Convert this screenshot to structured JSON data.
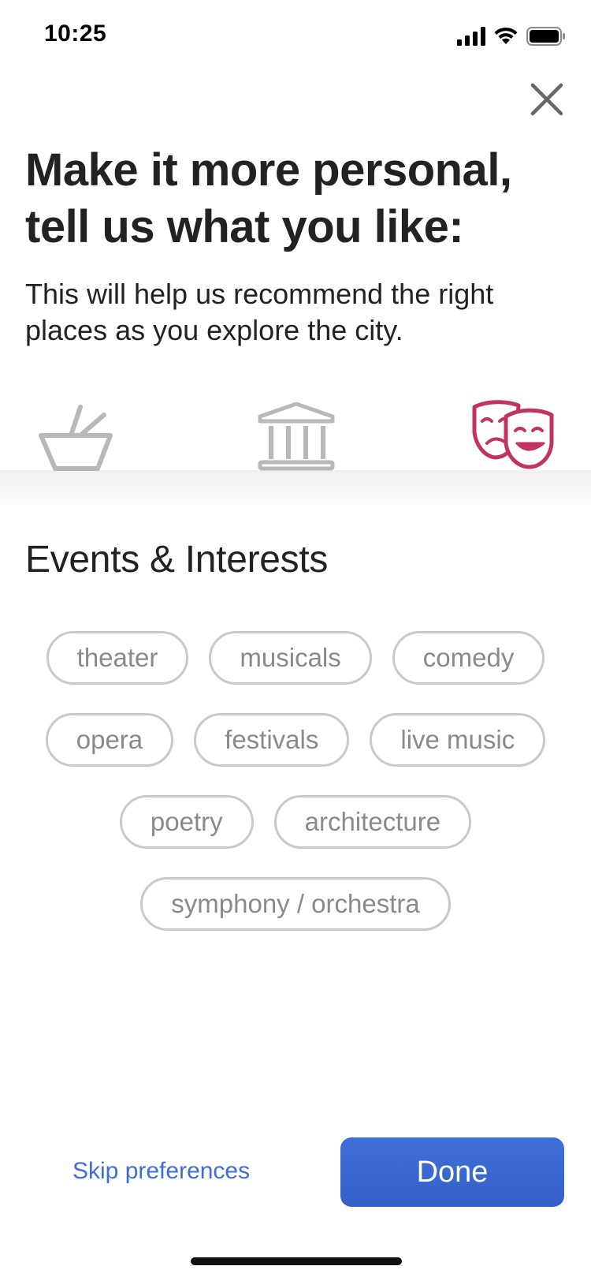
{
  "status_bar": {
    "time": "10:25"
  },
  "header": {
    "title": "Make it more personal, tell us what you like:",
    "subtitle": "This will help us recommend the right places as you explore the city."
  },
  "categories": [
    {
      "icon": "bowl-icon",
      "selected": false
    },
    {
      "icon": "museum-icon",
      "selected": false
    },
    {
      "icon": "theater-masks-icon",
      "selected": true
    }
  ],
  "colors": {
    "accent": "#c2335e",
    "inactive_icon": "#b8b8b8",
    "link": "#3d6fd3",
    "button": "#3a68d0",
    "chip_border": "#c9c9c9",
    "chip_text": "#8a8a8a"
  },
  "section": {
    "title": "Events & Interests"
  },
  "chips": {
    "rows": [
      [
        "theater",
        "musicals",
        "comedy"
      ],
      [
        "opera",
        "festivals",
        "live music"
      ],
      [
        "poetry",
        "architecture"
      ],
      [
        "symphony / orchestra"
      ]
    ]
  },
  "footer": {
    "skip_label": "Skip preferences",
    "done_label": "Done"
  }
}
